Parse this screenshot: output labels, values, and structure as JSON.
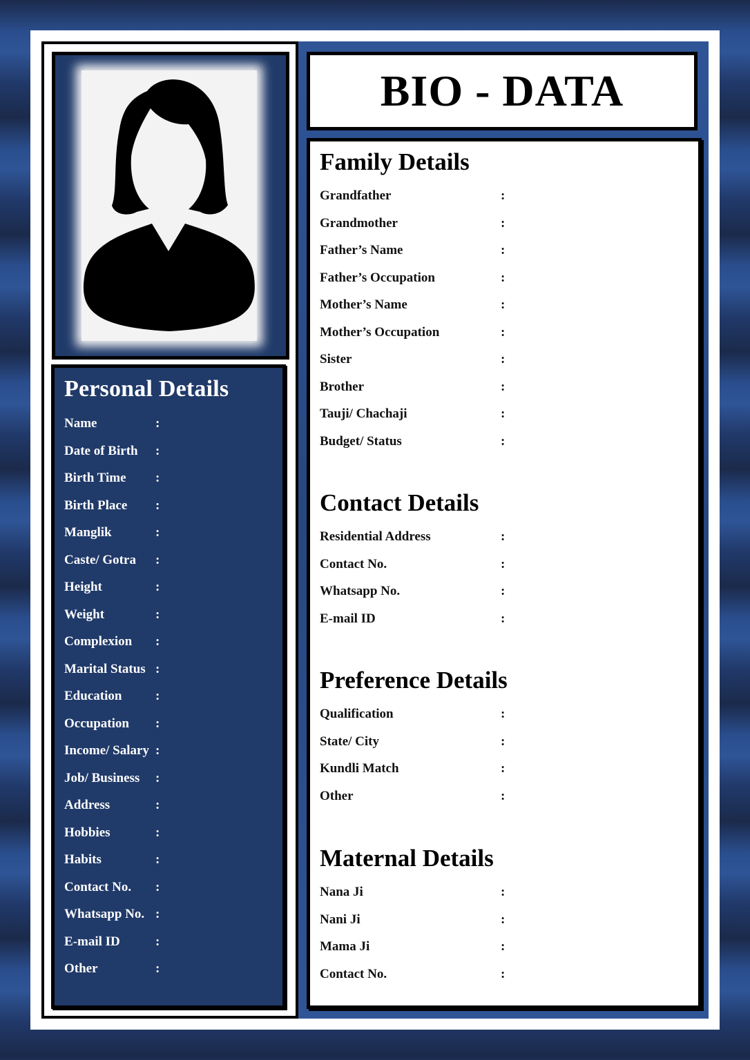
{
  "title": "BIO - DATA",
  "photo": {
    "icon": "female-avatar-silhouette-icon"
  },
  "personal": {
    "heading": "Personal Details",
    "fields": [
      {
        "label": "Name",
        "value": ""
      },
      {
        "label": "Date of Birth",
        "value": ""
      },
      {
        "label": "Birth Time",
        "value": ""
      },
      {
        "label": "Birth Place",
        "value": ""
      },
      {
        "label": "Manglik",
        "value": ""
      },
      {
        "label": "Caste/ Gotra",
        "value": ""
      },
      {
        "label": "Height",
        "value": ""
      },
      {
        "label": "Weight",
        "value": ""
      },
      {
        "label": "Complexion",
        "value": ""
      },
      {
        "label": "Marital Status",
        "value": ""
      },
      {
        "label": "Education",
        "value": ""
      },
      {
        "label": "Occupation",
        "value": ""
      },
      {
        "label": "Income/ Salary",
        "value": ""
      },
      {
        "label": "Job/ Business",
        "value": ""
      },
      {
        "label": "Address",
        "value": ""
      },
      {
        "label": "Hobbies",
        "value": ""
      },
      {
        "label": "Habits",
        "value": ""
      },
      {
        "label": "Contact No.",
        "value": ""
      },
      {
        "label": "Whatsapp No.",
        "value": ""
      },
      {
        "label": "E-mail ID",
        "value": ""
      },
      {
        "label": "Other",
        "value": ""
      }
    ]
  },
  "sections": [
    {
      "heading": "Family Details",
      "fields": [
        {
          "label": "Grandfather",
          "value": ""
        },
        {
          "label": "Grandmother",
          "value": ""
        },
        {
          "label": "Father’s Name",
          "value": ""
        },
        {
          "label": "Father’s Occupation",
          "value": ""
        },
        {
          "label": "Mother’s Name",
          "value": ""
        },
        {
          "label": "Mother’s Occupation",
          "value": ""
        },
        {
          "label": "Sister",
          "value": ""
        },
        {
          "label": "Brother",
          "value": ""
        },
        {
          "label": "Tauji/ Chachaji",
          "value": ""
        },
        {
          "label": "Budget/ Status",
          "value": ""
        }
      ]
    },
    {
      "heading": "Contact Details",
      "fields": [
        {
          "label": "Residential Address",
          "value": ""
        },
        {
          "label": "Contact No.",
          "value": ""
        },
        {
          "label": "Whatsapp No.",
          "value": ""
        },
        {
          "label": "E-mail ID",
          "value": ""
        }
      ]
    },
    {
      "heading": "Preference Details",
      "fields": [
        {
          "label": "Qualification",
          "value": ""
        },
        {
          "label": "State/ City",
          "value": ""
        },
        {
          "label": "Kundli Match",
          "value": ""
        },
        {
          "label": "Other",
          "value": ""
        }
      ]
    },
    {
      "heading": "Maternal Details",
      "fields": [
        {
          "label": "Nana Ji",
          "value": ""
        },
        {
          "label": "Nani Ji",
          "value": ""
        },
        {
          "label": "Mama Ji",
          "value": ""
        },
        {
          "label": "Contact No.",
          "value": ""
        }
      ]
    }
  ],
  "separator": ":",
  "colors": {
    "navy": "#203a69",
    "accent_blue": "#2f5597",
    "border": "#000000",
    "paper": "#ffffff"
  }
}
